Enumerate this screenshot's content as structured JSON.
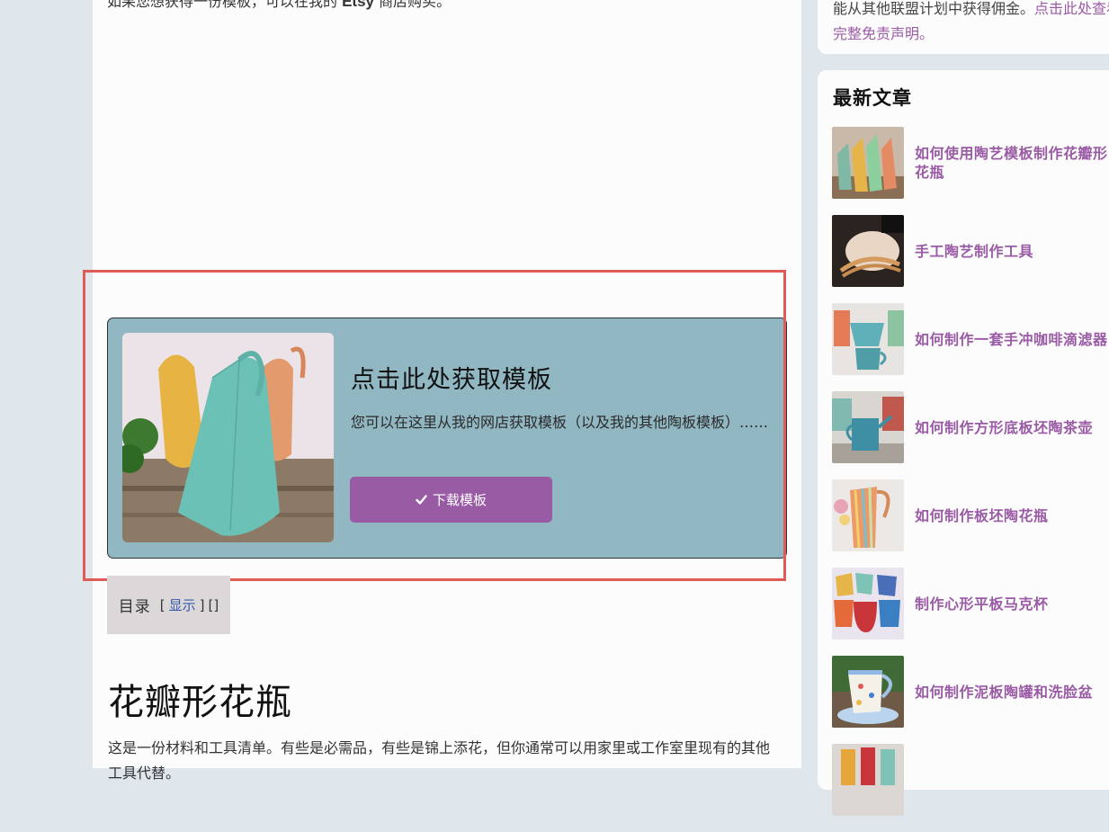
{
  "main": {
    "top_line_prefix": "如果您想获得一份模板，可以在我的 ",
    "top_line_brand": "Etsy",
    "top_line_suffix": " 商店购买。",
    "promo": {
      "title": "点击此处获取模板",
      "description": "您可以在这里从我的网店获取模板（以及我的其他陶板模板）……",
      "button_label": "下载模板",
      "button_icon": "check-icon"
    },
    "toc": {
      "title": "目录",
      "open_bracket": "[",
      "toggle_label": "显示",
      "close_bracket": "]",
      "empty_brackets": "[]"
    },
    "section": {
      "heading": "花瓣形花瓶",
      "body": "这是一份材料和工具清单。有些是必需品，有些是锦上添花，但你通常可以用家里或工作室里现有的其他工具代替。"
    }
  },
  "sidebar": {
    "top_text": "能从其他联盟计划中获得佣金。",
    "top_link": "点击此处查看完整免责声明。",
    "posts_heading": "最新文章",
    "posts": [
      {
        "title": "如何使用陶艺模板制作花瓣形花瓶"
      },
      {
        "title": "手工陶艺制作工具"
      },
      {
        "title": "如何制作一套手冲咖啡滴滤器"
      },
      {
        "title": "如何制作方形底板坯陶茶壶"
      },
      {
        "title": "如何制作板坯陶花瓶"
      },
      {
        "title": "制作心形平板马克杯"
      },
      {
        "title": "如何制作泥板陶罐和洗脸盆"
      }
    ]
  },
  "colors": {
    "accent": "#9a5ba5",
    "promo_bg": "#91b7c2",
    "highlight": "#df5b55",
    "page_bg": "#dfe6ec"
  }
}
